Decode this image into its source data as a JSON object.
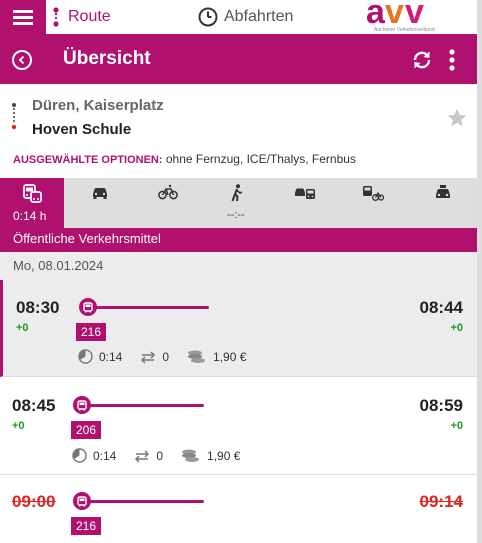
{
  "topbar": {
    "route_label": "Route",
    "departures_label": "Abfahrten",
    "logo_text": "avv",
    "logo_subtext": "Aachener Verkehrsverbund"
  },
  "header": {
    "title": "Übersicht"
  },
  "route": {
    "from": "Düren, Kaiserplatz",
    "to": "Hoven Schule",
    "options_label": "AUSGEWÄHLTE OPTIONEN:",
    "options_value": "ohne Fernzug, ICE/Thalys, Fernbus"
  },
  "modes": {
    "items": [
      "public-transport",
      "car",
      "bike",
      "walk",
      "park-and-ride",
      "bike-and-ride",
      "taxi"
    ],
    "active_duration": "0:14 h",
    "walk_duration": "--:--"
  },
  "section_title": "Öffentliche Verkehrsmittel",
  "date": "Mo, 08.01.2024",
  "connections": [
    {
      "dep": "08:30",
      "dep_delay": "+0",
      "arr": "08:44",
      "arr_delay": "+0",
      "line": "216",
      "duration": "0:14",
      "transfers": "0",
      "price": "1,90 €",
      "selected": true,
      "cancelled": false
    },
    {
      "dep": "08:45",
      "dep_delay": "+0",
      "arr": "08:59",
      "arr_delay": "+0",
      "line": "206",
      "duration": "0:14",
      "transfers": "0",
      "price": "1,90 €",
      "selected": false,
      "cancelled": false
    },
    {
      "dep": "09:00",
      "arr": "09:14",
      "line": "216",
      "selected": false,
      "cancelled": true
    }
  ],
  "colors": {
    "brand": "#b0116f",
    "delay_ok": "#1a9b1a",
    "cancelled": "#e32222"
  }
}
